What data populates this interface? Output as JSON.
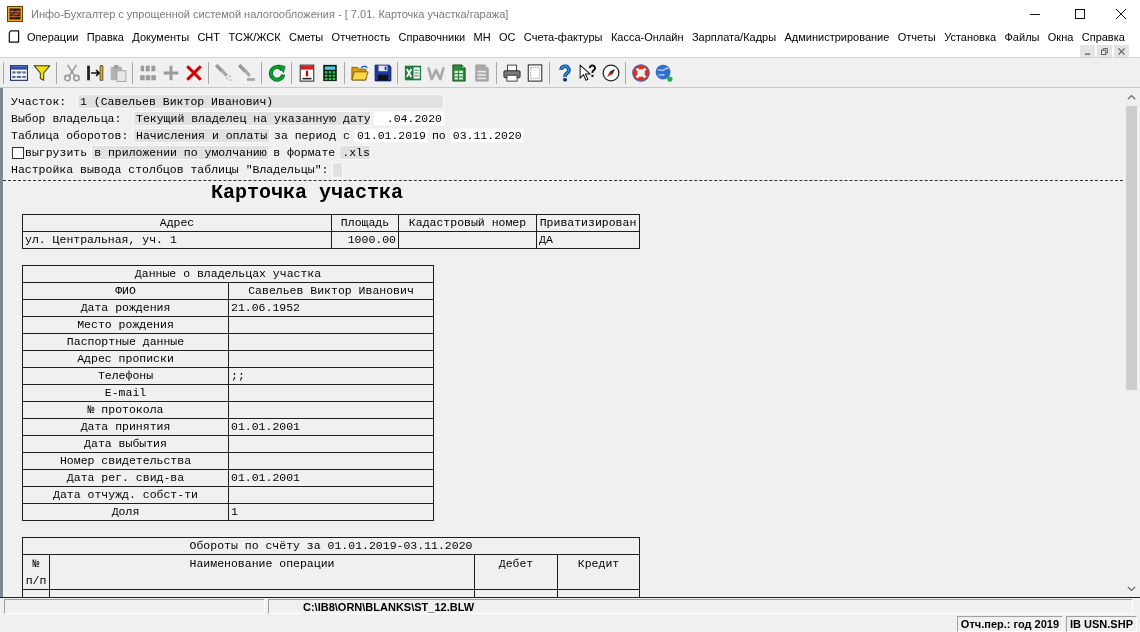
{
  "window": {
    "title": "Инфо-Бухгалтер с упрощенной системой налогообложения - [ 7.01. Карточка участка/гаража]"
  },
  "menu": [
    "Операции",
    "Правка",
    "Документы",
    "СНТ",
    "ТСЖ/ЖСК",
    "Сметы",
    "Отчетность",
    "Справочники",
    "МН",
    "ОС",
    "Счета-фактуры",
    "Касса-Онлайн",
    "Зарплата/Кадры",
    "Администрирование",
    "Отчеты",
    "Установка",
    "Файлы",
    "Окна",
    "Справка"
  ],
  "toolbar": {
    "groups": [
      [
        {
          "disabled": false
        },
        {
          "disabled": false
        }
      ],
      [
        {
          "disabled": true
        },
        {
          "disabled": false
        },
        {
          "disabled": true
        }
      ],
      [
        {
          "disabled": true
        },
        {
          "disabled": true
        },
        {
          "disabled": false
        }
      ],
      [
        {
          "disabled": true
        },
        {
          "disabled": true
        }
      ],
      [
        {
          "disabled": false
        }
      ],
      [
        {
          "disabled": false
        },
        {
          "disabled": false
        }
      ],
      [
        {
          "disabled": false
        },
        {
          "disabled": false
        }
      ],
      [
        {
          "disabled": false
        },
        {
          "disabled": true
        },
        {
          "disabled": false
        },
        {
          "disabled": true
        }
      ],
      [
        {
          "disabled": false
        },
        {
          "disabled": false
        }
      ],
      [
        {
          "disabled": false
        },
        {
          "disabled": false
        },
        {
          "disabled": false
        }
      ],
      [
        {
          "disabled": false
        },
        {
          "disabled": false
        }
      ]
    ]
  },
  "form": {
    "plot": {
      "label": "Участок:",
      "value": "1 (Савельев Виктор Иванович)"
    },
    "owner": {
      "label": "Выбор владельца:",
      "mode": "Текущий владелец на указанную дату",
      "date": ".04.2020"
    },
    "turnover": {
      "label": "Таблица оборотов:",
      "mode": "Начисления и оплаты",
      "from_label": "за период с",
      "from": "01.01.2019",
      "to_label": "по",
      "to": "03.11.2020"
    },
    "export": {
      "checked": false,
      "label": "выгрузить",
      "target": "в приложении по умолчанию",
      "format_label": "в формате",
      "format": ".xls"
    },
    "columns": {
      "label": "Настройка вывода столбцов таблицы \"Владельцы\":"
    }
  },
  "report": {
    "title": "Карточка участка",
    "plot_table": {
      "columns": [
        "Адрес",
        "Площадь",
        "Кадастровый номер",
        "Приватизирован"
      ],
      "rows": [
        {
          "address": "ул. Центральная, уч. 1",
          "area": "1000.00",
          "privatized": "ДА"
        }
      ]
    },
    "owners_table": {
      "title": "Данные о владельцах участка",
      "columns": [
        "ФИО",
        "Савельев Виктор Иванович"
      ],
      "rows": [
        {
          "label": "Дата рождения",
          "value": "21.06.1952"
        },
        {
          "label": "Место рождения"
        },
        {
          "label": "Паспортные данные"
        },
        {
          "label": "Адрес прописки"
        },
        {
          "label": "Телефоны",
          "value": ";;"
        },
        {
          "label": "E-mail"
        },
        {
          "label": "№ протокола"
        },
        {
          "label": "Дата принятия",
          "value": "01.01.2001"
        },
        {
          "label": "Дата выбытия"
        },
        {
          "label": "Номер свидетельства"
        },
        {
          "label": "Дата рег. свид-ва",
          "value": "01.01.2001"
        },
        {
          "label": "Дата отчужд. собст-ти"
        },
        {
          "label": "Доля",
          "value": "1"
        }
      ]
    },
    "turnover_table": {
      "title": "Обороты по счёту за 01.01.2019-03.11.2020",
      "columns": [
        "№ п/п",
        "Наименование операции",
        "Дебет",
        "Кредит"
      ]
    }
  },
  "path_bar": {
    "path": "C:\\IB8\\ORN\\BLANKS\\ST_12.BLW"
  },
  "status_bar": [
    "Отч.пер.: год 2019",
    "IB USN.SHP"
  ]
}
